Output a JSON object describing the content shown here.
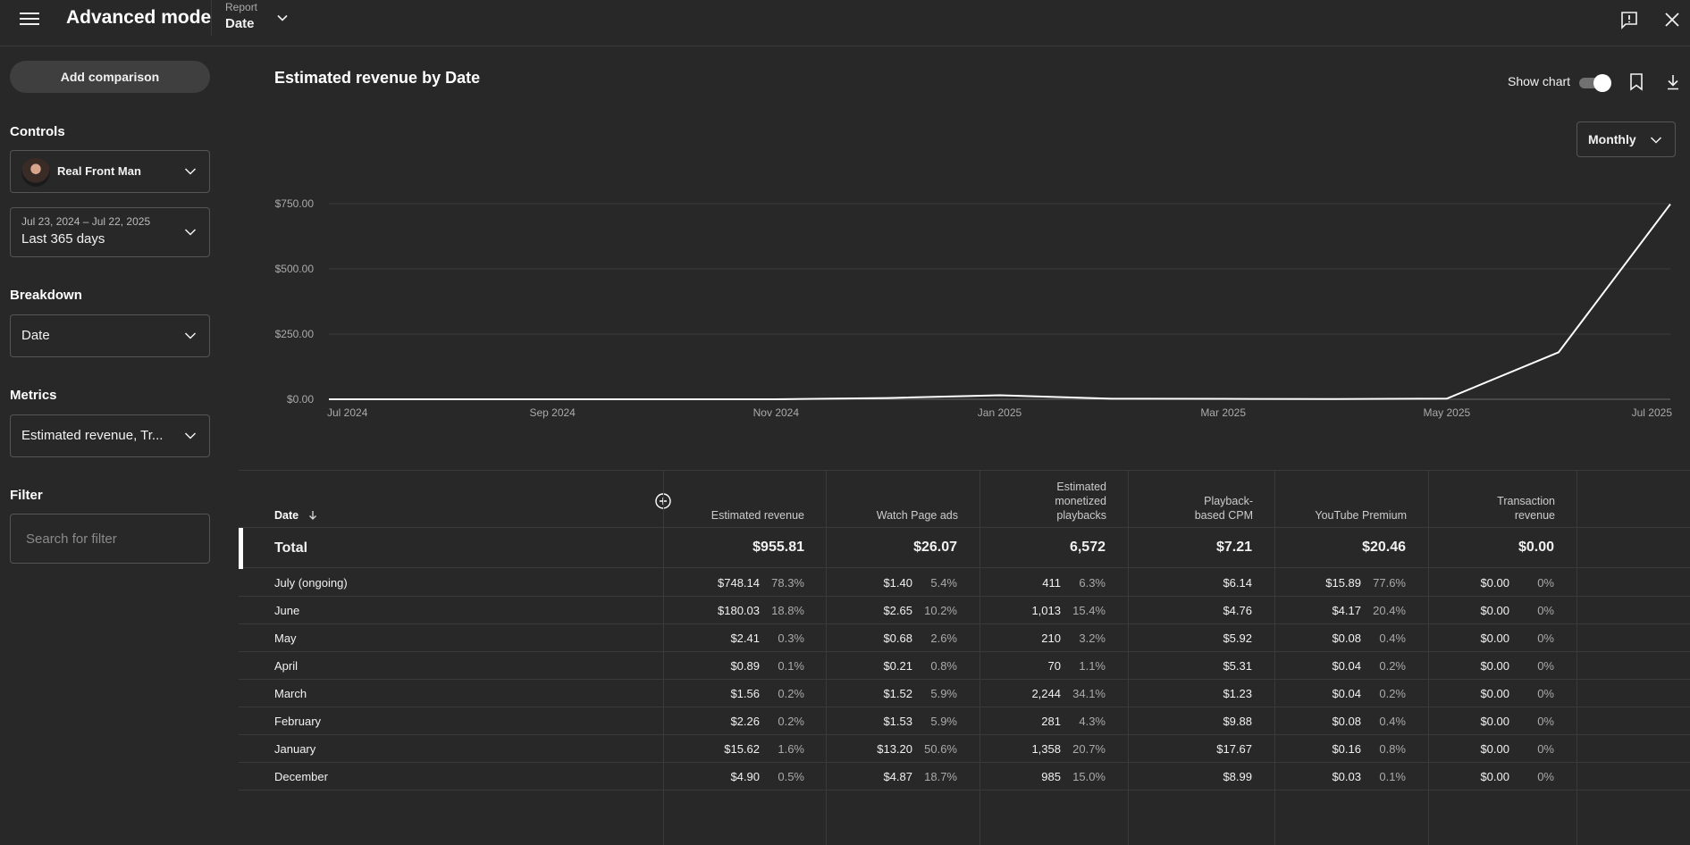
{
  "header": {
    "title": "Advanced mode",
    "report_label": "Report",
    "report_value": "Date"
  },
  "sidebar": {
    "add_comparison": "Add comparison",
    "controls_label": "Controls",
    "channel_name": "Real Front Man",
    "date_range_sub": "Jul 23, 2024 – Jul 22, 2025",
    "date_range_main": "Last 365 days",
    "breakdown_label": "Breakdown",
    "breakdown_value": "Date",
    "metrics_label": "Metrics",
    "metrics_value": "Estimated revenue, Tr...",
    "filter_label": "Filter",
    "filter_placeholder": "Search for filter"
  },
  "chart_header": {
    "title": "Estimated revenue by Date",
    "show_chart": "Show chart",
    "interval": "Monthly"
  },
  "chart_data": {
    "type": "line",
    "title": "Estimated revenue by Date",
    "x": [
      "Jul 2024",
      "Aug 2024",
      "Sep 2024",
      "Oct 2024",
      "Nov 2024",
      "Dec 2024",
      "Jan 2025",
      "Feb 2025",
      "Mar 2025",
      "Apr 2025",
      "May 2025",
      "Jun 2025",
      "Jul 2025"
    ],
    "x_tick_labels": [
      "Jul 2024",
      "Sep 2024",
      "Nov 2024",
      "Jan 2025",
      "Mar 2025",
      "May 2025",
      "Jul 2025"
    ],
    "series": [
      {
        "values": [
          0,
          0,
          0,
          0,
          0,
          4.9,
          15.62,
          2.26,
          1.56,
          0.89,
          2.41,
          180.03,
          748.14
        ]
      }
    ],
    "y_ticks": [
      "$750.00",
      "$500.00",
      "$250.00",
      "$0.00"
    ],
    "ylim": [
      0,
      750
    ],
    "grid": true,
    "line_color": "#ffffff"
  },
  "table": {
    "date_header": "Date",
    "columns": [
      {
        "label": "Estimated revenue",
        "total": "$955.81"
      },
      {
        "label": "Watch Page ads",
        "total": "$26.07"
      },
      {
        "label": "Estimated monetized playbacks",
        "total": "6,572"
      },
      {
        "label": "Playback-based CPM",
        "total": "$7.21"
      },
      {
        "label": "YouTube Premium",
        "total": "$20.46"
      },
      {
        "label": "Transaction revenue",
        "total": "$0.00"
      }
    ],
    "total_label": "Total",
    "rows": [
      {
        "date": "July (ongoing)",
        "rev": "$748.14",
        "rev_pct": "78.3%",
        "wpa": "$1.40",
        "wpa_pct": "5.4%",
        "mp": "411",
        "mp_pct": "6.3%",
        "cpm": "$6.14",
        "ytp": "$15.89",
        "ytp_pct": "77.6%",
        "tr": "$0.00",
        "tr_pct": "0%"
      },
      {
        "date": "June",
        "rev": "$180.03",
        "rev_pct": "18.8%",
        "wpa": "$2.65",
        "wpa_pct": "10.2%",
        "mp": "1,013",
        "mp_pct": "15.4%",
        "cpm": "$4.76",
        "ytp": "$4.17",
        "ytp_pct": "20.4%",
        "tr": "$0.00",
        "tr_pct": "0%"
      },
      {
        "date": "May",
        "rev": "$2.41",
        "rev_pct": "0.3%",
        "wpa": "$0.68",
        "wpa_pct": "2.6%",
        "mp": "210",
        "mp_pct": "3.2%",
        "cpm": "$5.92",
        "ytp": "$0.08",
        "ytp_pct": "0.4%",
        "tr": "$0.00",
        "tr_pct": "0%"
      },
      {
        "date": "April",
        "rev": "$0.89",
        "rev_pct": "0.1%",
        "wpa": "$0.21",
        "wpa_pct": "0.8%",
        "mp": "70",
        "mp_pct": "1.1%",
        "cpm": "$5.31",
        "ytp": "$0.04",
        "ytp_pct": "0.2%",
        "tr": "$0.00",
        "tr_pct": "0%"
      },
      {
        "date": "March",
        "rev": "$1.56",
        "rev_pct": "0.2%",
        "wpa": "$1.52",
        "wpa_pct": "5.9%",
        "mp": "2,244",
        "mp_pct": "34.1%",
        "cpm": "$1.23",
        "ytp": "$0.04",
        "ytp_pct": "0.2%",
        "tr": "$0.00",
        "tr_pct": "0%"
      },
      {
        "date": "February",
        "rev": "$2.26",
        "rev_pct": "0.2%",
        "wpa": "$1.53",
        "wpa_pct": "5.9%",
        "mp": "281",
        "mp_pct": "4.3%",
        "cpm": "$9.88",
        "ytp": "$0.08",
        "ytp_pct": "0.4%",
        "tr": "$0.00",
        "tr_pct": "0%"
      },
      {
        "date": "January",
        "rev": "$15.62",
        "rev_pct": "1.6%",
        "wpa": "$13.20",
        "wpa_pct": "50.6%",
        "mp": "1,358",
        "mp_pct": "20.7%",
        "cpm": "$17.67",
        "ytp": "$0.16",
        "ytp_pct": "0.8%",
        "tr": "$0.00",
        "tr_pct": "0%"
      },
      {
        "date": "December",
        "rev": "$4.90",
        "rev_pct": "0.5%",
        "wpa": "$4.87",
        "wpa_pct": "18.7%",
        "mp": "985",
        "mp_pct": "15.0%",
        "cpm": "$8.99",
        "ytp": "$0.03",
        "ytp_pct": "0.1%",
        "tr": "$0.00",
        "tr_pct": "0%"
      }
    ]
  }
}
